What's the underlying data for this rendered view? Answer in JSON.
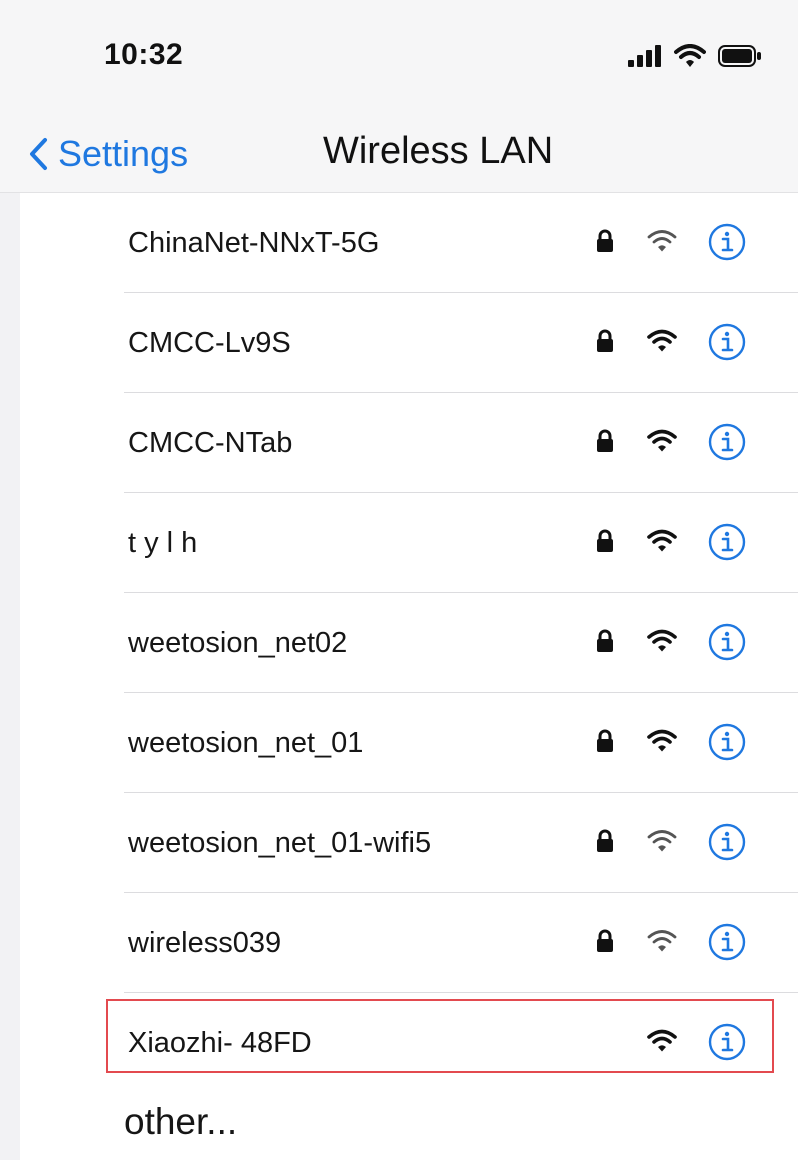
{
  "status_bar": {
    "time": "10:32",
    "icons": [
      "cellular-signal-icon",
      "wifi-status-icon",
      "battery-icon"
    ]
  },
  "nav": {
    "back_label": "Settings",
    "title": "Wireless LAN"
  },
  "networks": [
    {
      "name": "ChinaNet-NNxT-5G",
      "secured": true,
      "signal": "weak"
    },
    {
      "name": "CMCC-Lv9S",
      "secured": true,
      "signal": "strong"
    },
    {
      "name": "CMCC-NTab",
      "secured": true,
      "signal": "strong"
    },
    {
      "name": "t y l h",
      "secured": true,
      "signal": "strong"
    },
    {
      "name": "weetosion_net02",
      "secured": true,
      "signal": "strong"
    },
    {
      "name": "weetosion_net_01",
      "secured": true,
      "signal": "strong"
    },
    {
      "name": "weetosion_net_01-wifi5",
      "secured": true,
      "signal": "weak"
    },
    {
      "name": "wireless039",
      "secured": true,
      "signal": "weak"
    },
    {
      "name": "Xiaozhi- 48FD",
      "secured": false,
      "signal": "strong",
      "highlighted": true
    }
  ],
  "other": {
    "label": "other..."
  },
  "colors": {
    "accent": "#1f78e0",
    "highlight": "#e34a4f",
    "background": "#f6f6f7"
  }
}
